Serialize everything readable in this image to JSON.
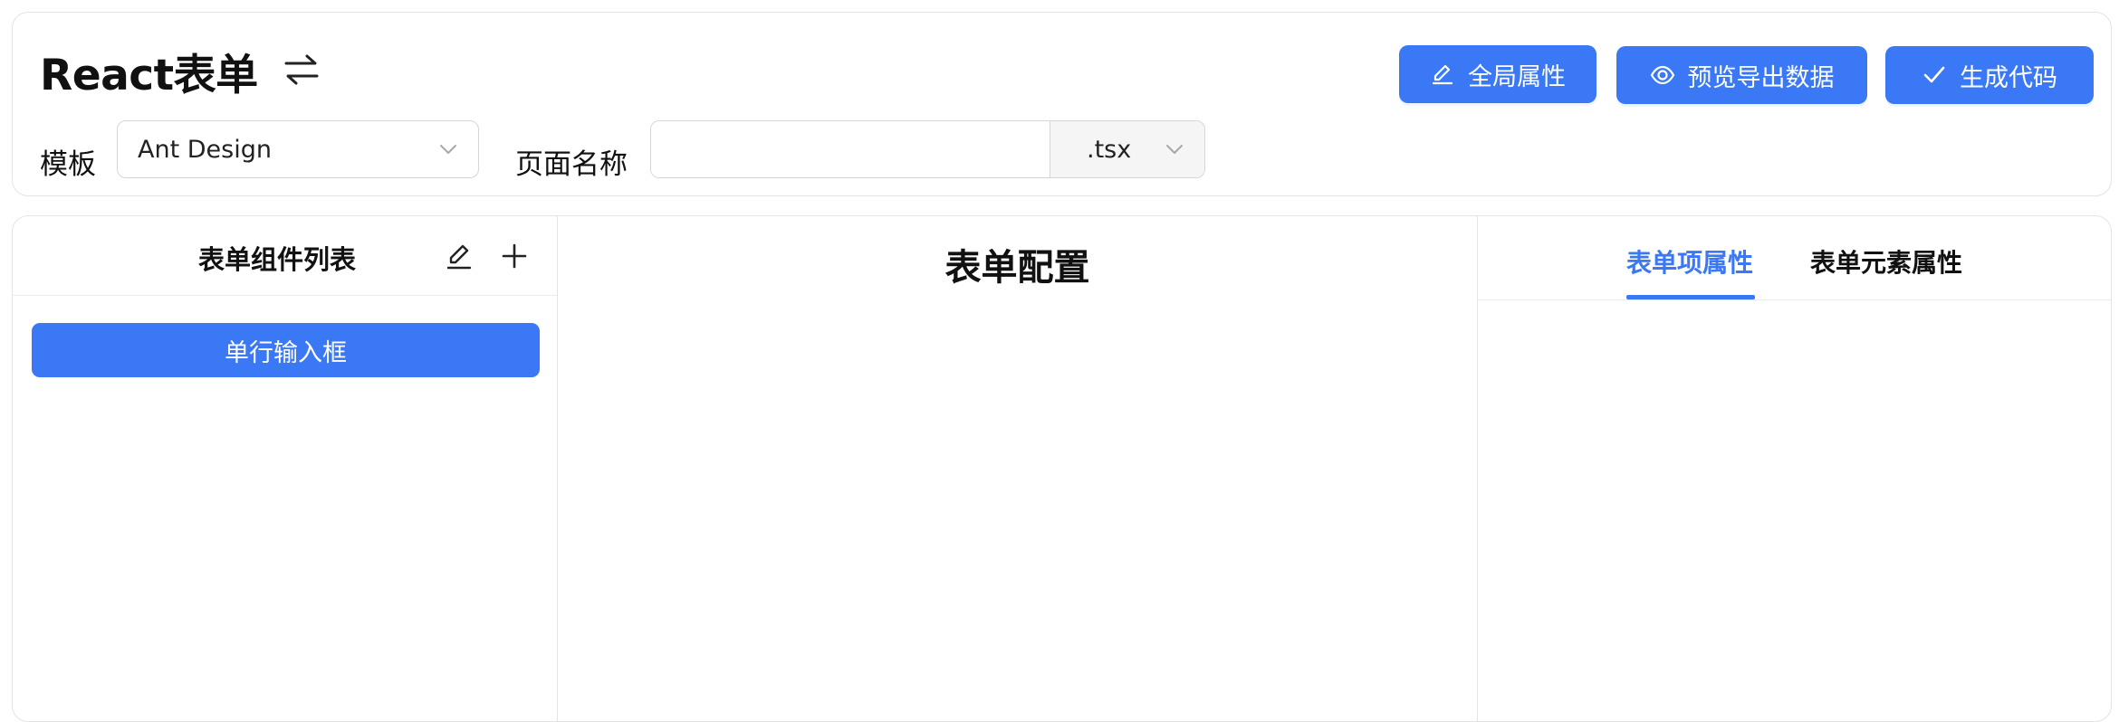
{
  "header": {
    "title": "React表单",
    "swap_icon": "swap-arrows-icon",
    "buttons": {
      "global_props": "全局属性",
      "preview_export": "预览导出数据",
      "generate_code": "生成代码"
    },
    "template_label": "模板",
    "template_value": "Ant Design",
    "page_name_label": "页面名称",
    "page_name_value": "",
    "page_name_placeholder": "",
    "suffix_value": ".tsx"
  },
  "left_panel": {
    "title": "表单组件列表",
    "components": [
      "单行输入框"
    ]
  },
  "center_panel": {
    "title": "表单配置"
  },
  "right_panel": {
    "tabs": [
      {
        "label": "表单项属性",
        "active": true
      },
      {
        "label": "表单元素属性",
        "active": false
      }
    ]
  },
  "colors": {
    "primary": "#3b78f5",
    "border": "#e3e3e3",
    "text": "#111111"
  }
}
